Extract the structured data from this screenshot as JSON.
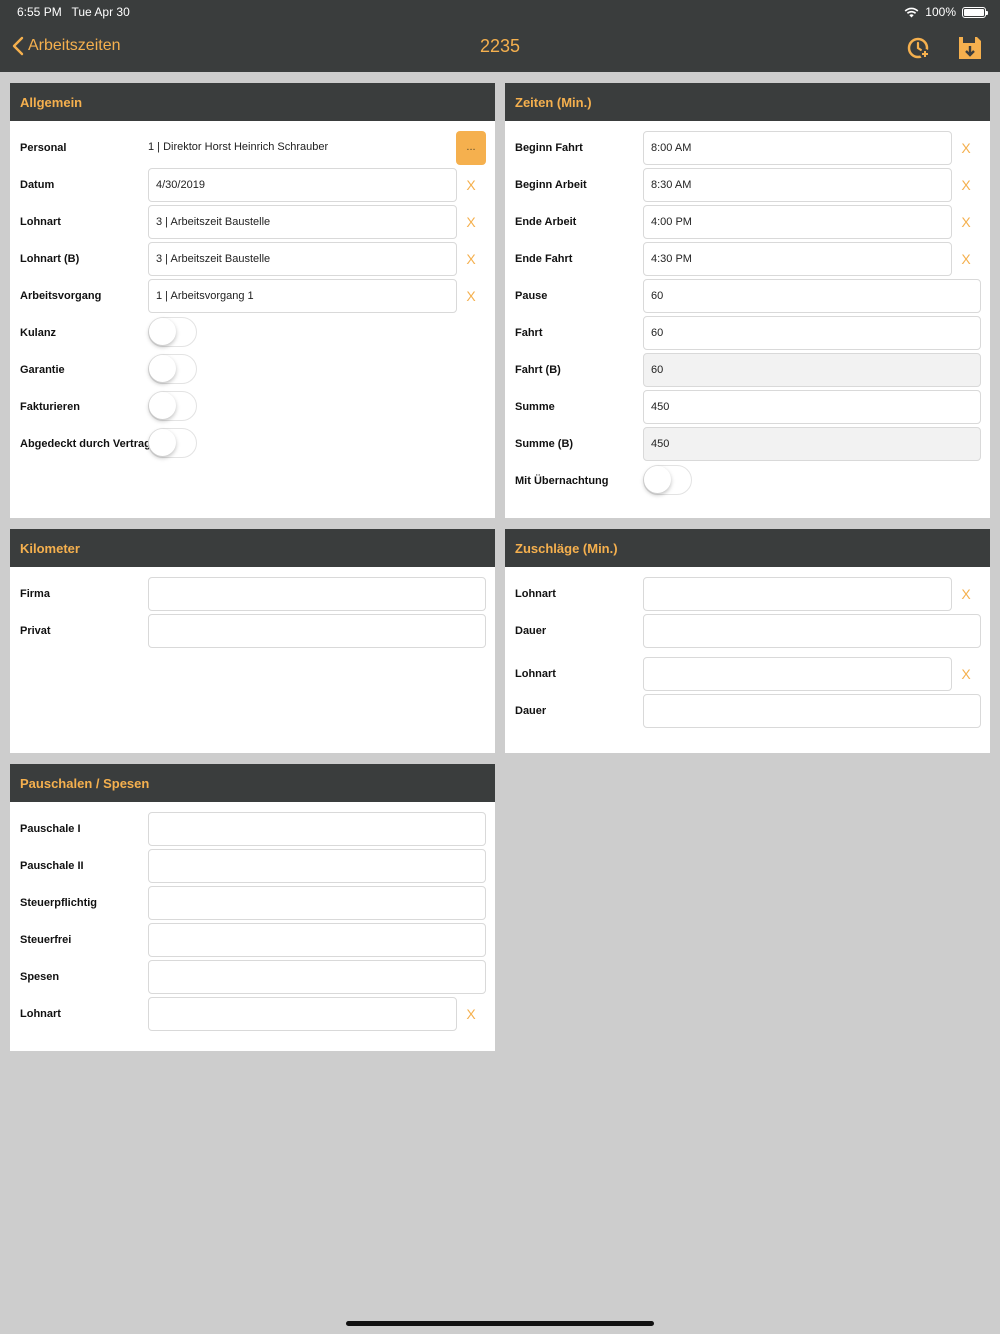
{
  "status": {
    "time": "6:55 PM",
    "date": "Tue Apr 30",
    "battery": "100%",
    "battery_level": 1.0,
    "wifi_icon": "wifi-icon"
  },
  "nav": {
    "back_label": "Arbeitszeiten",
    "title": "2235",
    "icons": [
      "clock-add-icon",
      "save-icon"
    ]
  },
  "colors": {
    "accent": "#f5b04e",
    "header_bg": "#3a3d3d",
    "page_bg": "#cdcdcd"
  },
  "allgemein": {
    "title": "Allgemein",
    "personal_label": "Personal",
    "personal_value": "1 | Direktor Horst Heinrich Schrauber",
    "dots_label": "...",
    "datum_label": "Datum",
    "datum_value": "4/30/2019",
    "lohnart_label": "Lohnart",
    "lohnart_value": "3 | Arbeitszeit Baustelle",
    "lohnart_b_label": "Lohnart (B)",
    "lohnart_b_value": "3 | Arbeitszeit Baustelle",
    "arbeitsvorgang_label": "Arbeitsvorgang",
    "arbeitsvorgang_value": "1 | Arbeitsvorgang 1",
    "kulanz_label": "Kulanz",
    "kulanz_on": false,
    "garantie_label": "Garantie",
    "garantie_on": false,
    "fakturieren_label": "Fakturieren",
    "fakturieren_on": false,
    "vertrag_label": "Abgedeckt durch Vertrag",
    "vertrag_on": false
  },
  "zeiten": {
    "title": "Zeiten (Min.)",
    "beginn_fahrt_label": "Beginn Fahrt",
    "beginn_fahrt_value": "8:00 AM",
    "beginn_arbeit_label": "Beginn Arbeit",
    "beginn_arbeit_value": "8:30 AM",
    "ende_arbeit_label": "Ende Arbeit",
    "ende_arbeit_value": "4:00 PM",
    "ende_fahrt_label": "Ende Fahrt",
    "ende_fahrt_value": "4:30 PM",
    "pause_label": "Pause",
    "pause_value": "60",
    "fahrt_label": "Fahrt",
    "fahrt_value": "60",
    "fahrt_b_label": "Fahrt (B)",
    "fahrt_b_value": "60",
    "summe_label": "Summe",
    "summe_value": "450",
    "summe_b_label": "Summe (B)",
    "summe_b_value": "450",
    "uebernachtung_label": "Mit Übernachtung",
    "uebernachtung_on": false
  },
  "kilometer": {
    "title": "Kilometer",
    "firma_label": "Firma",
    "firma_value": "",
    "privat_label": "Privat",
    "privat_value": ""
  },
  "zuschlaege": {
    "title": "Zuschläge (Min.)",
    "lohnart1_label": "Lohnart",
    "lohnart1_value": "",
    "dauer1_label": "Dauer",
    "dauer1_value": "",
    "lohnart2_label": "Lohnart",
    "lohnart2_value": "",
    "dauer2_label": "Dauer",
    "dauer2_value": ""
  },
  "pauschalen": {
    "title": "Pauschalen / Spesen",
    "pauschale1_label": "Pauschale I",
    "pauschale1_value": "",
    "pauschale2_label": "Pauschale II",
    "pauschale2_value": "",
    "steuerpflichtig_label": "Steuerpflichtig",
    "steuerpflichtig_value": "",
    "steuerfrei_label": "Steuerfrei",
    "steuerfrei_value": "",
    "spesen_label": "Spesen",
    "spesen_value": "",
    "lohnart_label": "Lohnart",
    "lohnart_value": ""
  },
  "clear_symbol": "X"
}
